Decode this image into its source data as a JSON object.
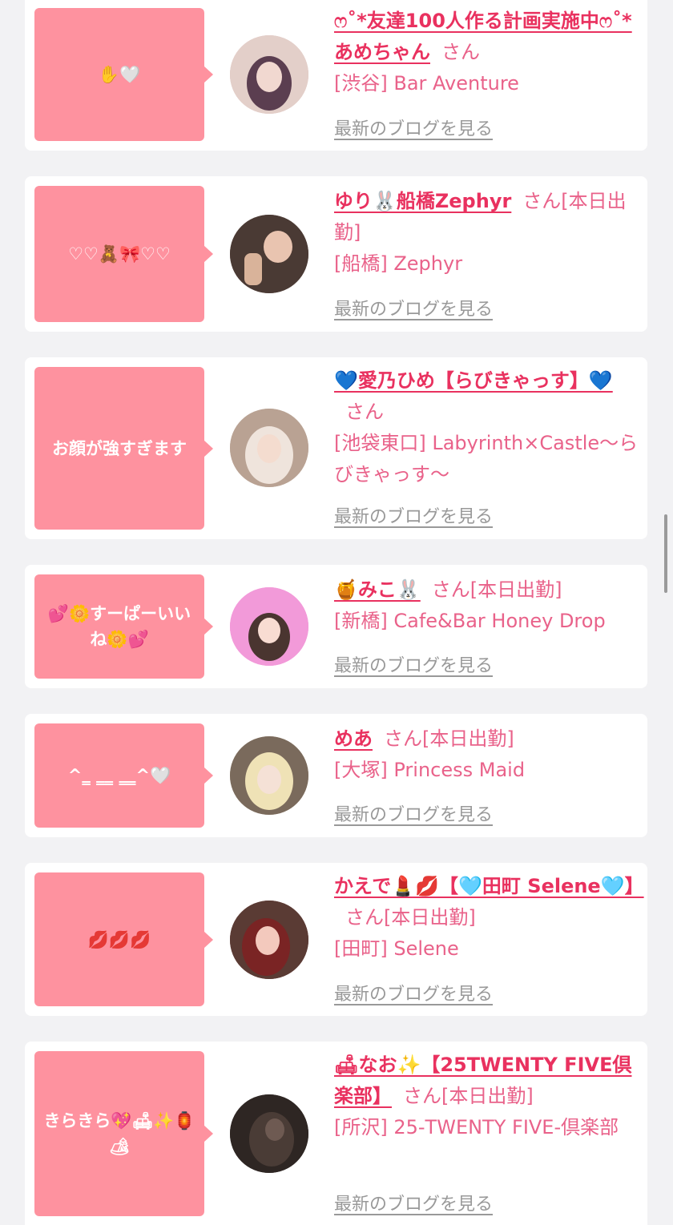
{
  "cards": [
    {
      "bubble": "✋🤍",
      "name": "ෆ˚*友達100人作る計画実施中ෆ˚*あめちゃん",
      "suffix": "さん",
      "shop": "[渋谷] Bar Aventure",
      "blog_link": "最新のブログを見る",
      "avatar_color": "#d9b8b4"
    },
    {
      "bubble": "♡♡🧸🎀♡♡",
      "name": "ゆり🐰船橋Zephyr",
      "suffix": "さん[本日出勤]",
      "shop": "[船橋] Zephyr",
      "blog_link": "最新のブログを見る",
      "avatar_color": "#6b5048"
    },
    {
      "bubble": "お顔が強すぎます",
      "name": "💙愛乃ひめ【らびきゃっす】💙",
      "suffix": "さん",
      "shop": "[池袋東口] Labyrinth×Castle〜らびきゃっす〜",
      "blog_link": "最新のブログを見る",
      "avatar_color": "#c8b5a6"
    },
    {
      "bubble": "💕🌼すーぱーいいね🌼💕",
      "name": "🍯みこ🐰",
      "suffix": "さん[本日出勤]",
      "shop": "[新橋] Cafe&Bar Honey Drop",
      "blog_link": "最新のブログを見る",
      "avatar_color": "#f58fd8"
    },
    {
      "bubble": "^‗ ‗‗ ‗‗^🤍",
      "name": "めあ",
      "suffix": "さん[本日出勤]",
      "shop": "[大塚] Princess Maid",
      "blog_link": "最新のブログを見る",
      "avatar_color": "#b9a58a"
    },
    {
      "bubble": "💋💋💋",
      "name": "かえで💄💋【🩵田町 Selene🩵】",
      "suffix": "さん[本日出勤]",
      "shop": "[田町] Selene",
      "blog_link": "最新のブログを見る",
      "avatar_color": "#6a2a2a"
    },
    {
      "bubble": "きらきら💖🛋✨🏮🏕",
      "name": "🛋なお✨【25TWENTY FIVE倶楽部】",
      "suffix": "さん[本日出勤]",
      "shop": "[所沢] 25-TWENTY FIVE-倶楽部",
      "blog_link": "最新のブログを見る",
      "avatar_color": "#3a302c"
    }
  ]
}
